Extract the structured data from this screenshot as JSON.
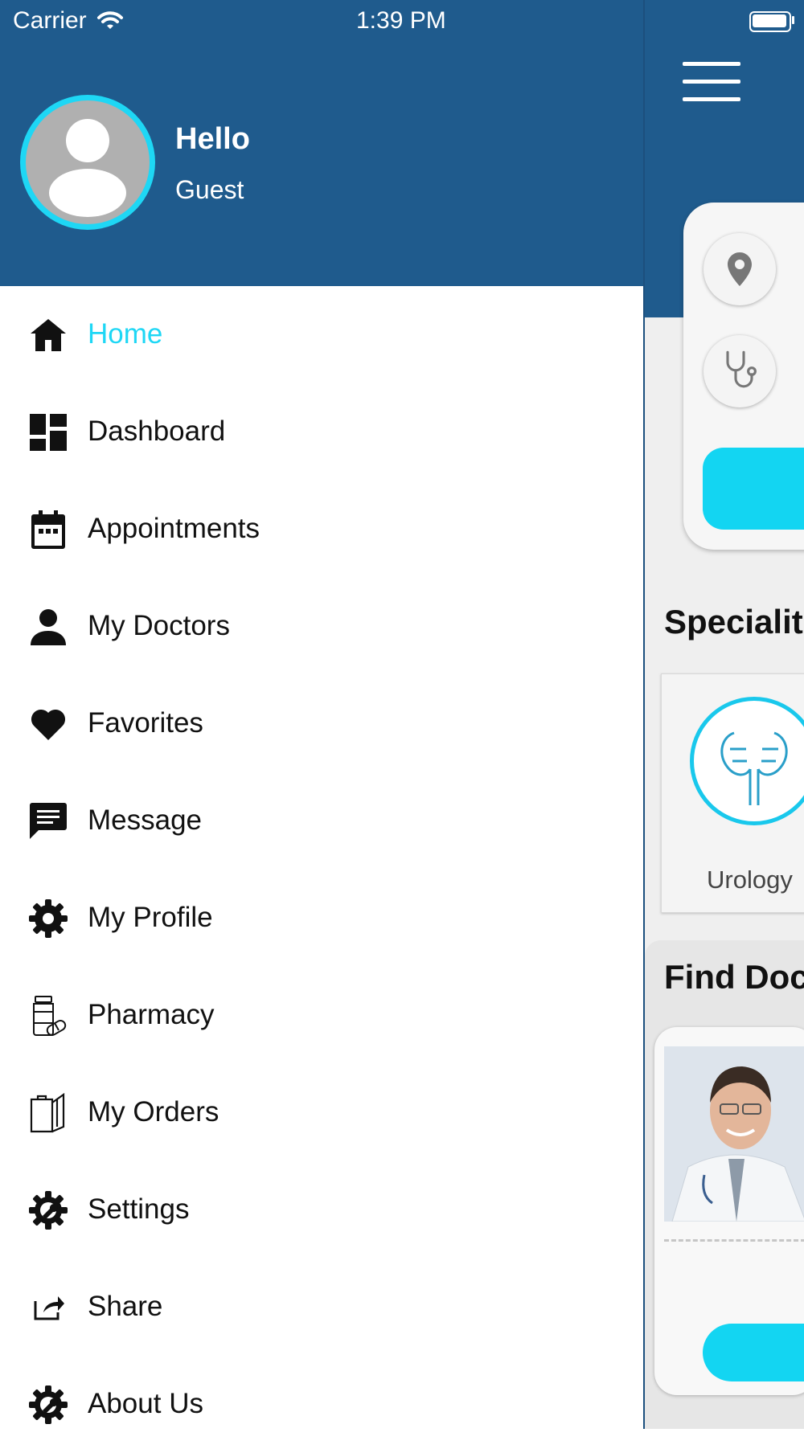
{
  "status_bar": {
    "carrier": "Carrier",
    "time": "1:39 PM"
  },
  "drawer": {
    "greeting": "Hello",
    "user_name": "Guest",
    "active_item": "home",
    "items": [
      {
        "id": "home",
        "label": "Home",
        "icon": "home-icon"
      },
      {
        "id": "dashboard",
        "label": "Dashboard",
        "icon": "dashboard-icon"
      },
      {
        "id": "appointments",
        "label": "Appointments",
        "icon": "calendar-icon"
      },
      {
        "id": "my-doctors",
        "label": "My Doctors",
        "icon": "person-icon"
      },
      {
        "id": "favorites",
        "label": "Favorites",
        "icon": "heart-icon"
      },
      {
        "id": "message",
        "label": "Message",
        "icon": "message-icon"
      },
      {
        "id": "my-profile",
        "label": "My Profile",
        "icon": "gear-icon"
      },
      {
        "id": "pharmacy",
        "label": "Pharmacy",
        "icon": "medicine-bottle-icon"
      },
      {
        "id": "my-orders",
        "label": "My Orders",
        "icon": "clipboard-icon"
      },
      {
        "id": "settings",
        "label": "Settings",
        "icon": "settings-gear-icon"
      },
      {
        "id": "share",
        "label": "Share",
        "icon": "share-icon"
      },
      {
        "id": "about-us",
        "label": "About Us",
        "icon": "about-gear-icon"
      }
    ]
  },
  "home": {
    "specialities_title": "Specialit",
    "speciality_name": "Urology",
    "find_doctors_title": "Find Doc"
  },
  "colors": {
    "primary": "#1f5b8d",
    "accent": "#1ed7f5",
    "text": "#111111"
  }
}
